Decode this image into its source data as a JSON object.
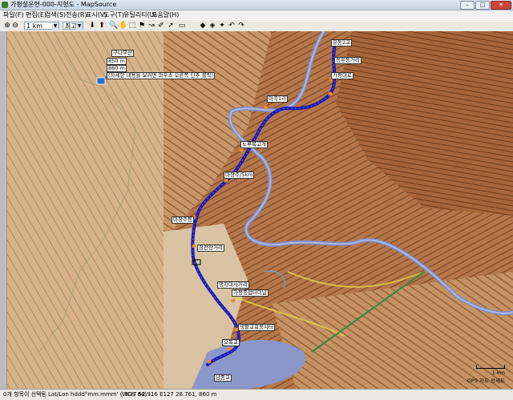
{
  "window": {
    "title": "가평설운현-000-지형도 - MapSource",
    "min": "–",
    "max": "□",
    "close": "✕"
  },
  "menu": [
    "파일(F)",
    "편집(E)",
    "검색(S)",
    "전송(R)",
    "표시(V)",
    "도구(T)",
    "유틸리티(U)",
    "도움말(H)"
  ],
  "toolbar": {
    "zoom_value": "1 km",
    "detail_value": "최고"
  },
  "info_box": {
    "title": "구나무산",
    "lines": [
      "850 m",
      "860 m",
      "(자세한 내용을 보려면 마우스 오른쪽 단추 클릭)"
    ]
  },
  "map_labels": [
    "유동2교",
    "동휴동거리",
    "가평대로",
    "마곡1리",
    "노루목고개",
    "마장주/5km",
    "마장주등",
    "장전장거리",
    "명지대사거리",
    "가평종합터미널",
    "생활교회봉사터",
    "오목교",
    "남종교"
  ],
  "scale": {
    "label": "1 km",
    "caption": "GPS 지도 상세도"
  },
  "status": {
    "selection": "0개 항목이 선택됨",
    "format": "Lat/Lon hddd°mm.mmm' (WGS 84)",
    "position": "N37 52.916 E127 28.761, 860 m"
  },
  "colors": {
    "route": "#1a1ab4",
    "water": "#7c8cc4",
    "terrain": "#a8653a"
  }
}
